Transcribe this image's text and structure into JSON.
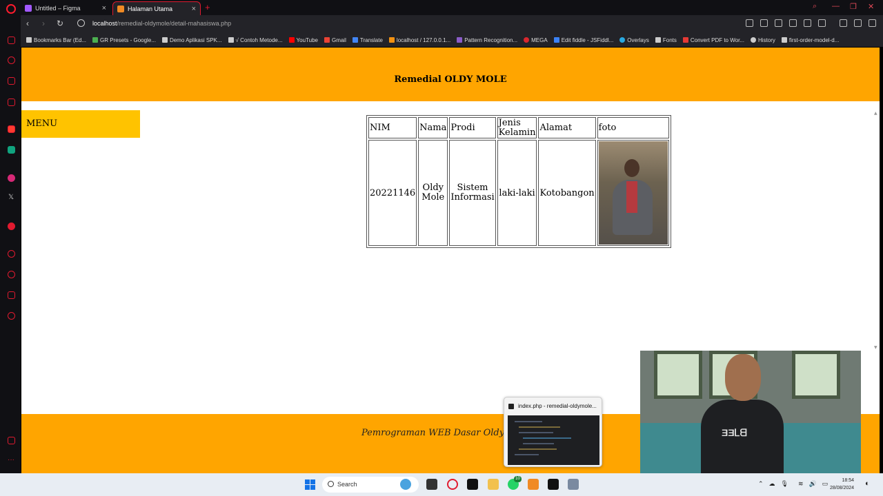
{
  "browser": {
    "tabs": [
      {
        "label": "Untitled – Figma",
        "close": "×"
      },
      {
        "label": "Halaman Utama",
        "close": "×"
      }
    ],
    "new_tab": "+",
    "url_host": "localhost",
    "url_path": "/remedial-oldymole/detail-mahasiswa.php",
    "bookmarks": [
      "Bookmarks Bar (Ed...",
      "GR Presets - Google...",
      "Demo Aplikasi SPK...",
      "√ Contoh Metode...",
      "YouTube",
      "Gmail",
      "Translate",
      "localhost / 127.0.0.1...",
      "Pattern Recognition...",
      "MEGA",
      "Edit fiddle - JSFiddl...",
      "Overlays",
      "Fonts",
      "Convert PDF to Wor...",
      "History",
      "first-order-model-d..."
    ]
  },
  "page": {
    "header_title": "Remedial OLDY MOLE",
    "menu_label": "MENU",
    "table": {
      "headers": [
        "NIM",
        "Nama",
        "Prodi",
        "Jenis Kelamin",
        "Alamat",
        "foto"
      ],
      "row": [
        "20221146",
        "Oldy Mole",
        "Sistem Informasi",
        "laki-laki",
        "Kotobangon"
      ]
    },
    "footer_text": "Pemrograman WEB Dasar Oldy M"
  },
  "taskbar": {
    "search_label": "Search",
    "preview_title": "index.php - remedial-oldymole...",
    "whatsapp_badge": "10",
    "time": "18:54",
    "date": "28/08/2024"
  },
  "colors": {
    "header_bg": "#ffa500",
    "menu_bg": "#ffc300",
    "opera_red": "#e11a2f"
  }
}
